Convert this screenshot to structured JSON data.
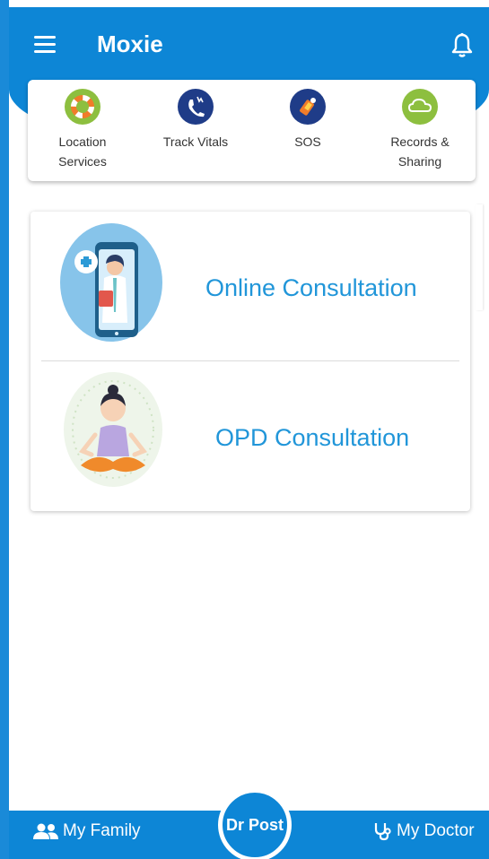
{
  "app": {
    "title": "Moxie"
  },
  "quick_actions": [
    {
      "label": "Location\nServices",
      "icon": "lifebuoy-icon",
      "color": "#8dbf3f"
    },
    {
      "label": "Track Vitals",
      "icon": "vitals-icon",
      "color": "#1f3c88"
    },
    {
      "label": "SOS",
      "icon": "sos-icon",
      "color": "#1f3c88"
    },
    {
      "label": "Records &\nSharing",
      "icon": "cloud-icon",
      "color": "#8dbf3f"
    }
  ],
  "consultations": [
    {
      "label": "Online Consultation",
      "illustration": "doctor-phone-illustration"
    },
    {
      "label": "OPD Consultation",
      "illustration": "meditation-illustration"
    }
  ],
  "bottom_nav": {
    "left_label": "My Family",
    "center_label": "Dr Post",
    "right_label": "My Doctor"
  },
  "colors": {
    "primary": "#0d86d6",
    "link": "#2196d9",
    "green": "#8dbf3f",
    "navy": "#1f3c88"
  }
}
